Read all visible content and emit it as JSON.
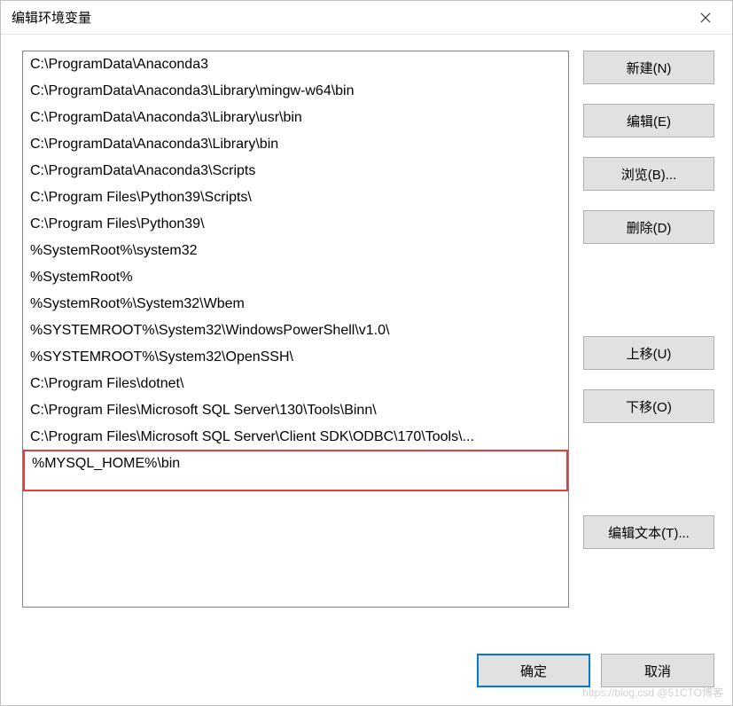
{
  "title": "编辑环境变量",
  "items": [
    "C:\\ProgramData\\Anaconda3",
    "C:\\ProgramData\\Anaconda3\\Library\\mingw-w64\\bin",
    "C:\\ProgramData\\Anaconda3\\Library\\usr\\bin",
    "C:\\ProgramData\\Anaconda3\\Library\\bin",
    "C:\\ProgramData\\Anaconda3\\Scripts",
    "C:\\Program Files\\Python39\\Scripts\\",
    "C:\\Program Files\\Python39\\",
    "%SystemRoot%\\system32",
    "%SystemRoot%",
    "%SystemRoot%\\System32\\Wbem",
    "%SYSTEMROOT%\\System32\\WindowsPowerShell\\v1.0\\",
    "%SYSTEMROOT%\\System32\\OpenSSH\\",
    "C:\\Program Files\\dotnet\\",
    "C:\\Program Files\\Microsoft SQL Server\\130\\Tools\\Binn\\",
    "C:\\Program Files\\Microsoft SQL Server\\Client SDK\\ODBC\\170\\Tools\\...",
    "%MYSQL_HOME%\\bin"
  ],
  "highlighted_index": 15,
  "buttons": {
    "new": "新建(N)",
    "edit": "编辑(E)",
    "browse": "浏览(B)...",
    "delete": "删除(D)",
    "move_up": "上移(U)",
    "move_down": "下移(O)",
    "edit_text": "编辑文本(T)..."
  },
  "bottom": {
    "ok": "确定",
    "cancel": "取消"
  },
  "watermark": "https://blog.csd @51CTO博客"
}
